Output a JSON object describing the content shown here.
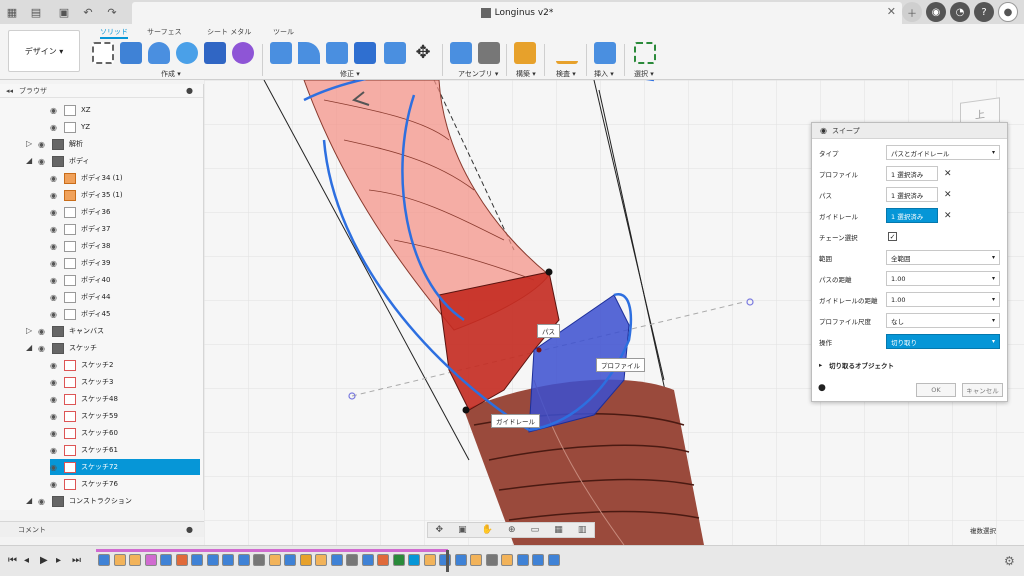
{
  "app": {
    "title": "Longinus v2*",
    "workspace_button": "デザイン ▾"
  },
  "ribbon": {
    "tabs": [
      "ソリッド",
      "サーフェス",
      "シート メタル",
      "ツール"
    ],
    "groups": [
      "作成 ▾",
      "修正 ▾",
      "アセンブリ ▾",
      "構築 ▾",
      "検査 ▾",
      "挿入 ▾",
      "選択 ▾"
    ]
  },
  "browser": {
    "title": "ブラウザ",
    "rows": [
      {
        "label": "XZ",
        "icon": "plane-icon"
      },
      {
        "label": "YZ",
        "icon": "plane-icon"
      },
      {
        "label": "解析",
        "icon": "folder-icon"
      },
      {
        "label": "ボディ",
        "icon": "folder-icon"
      },
      {
        "label": "ボディ34 (1)",
        "icon": "body-icon"
      },
      {
        "label": "ボディ35 (1)",
        "icon": "body-icon"
      },
      {
        "label": "ボディ36",
        "icon": "body-icon"
      },
      {
        "label": "ボディ37",
        "icon": "body-icon"
      },
      {
        "label": "ボディ38",
        "icon": "body-icon"
      },
      {
        "label": "ボディ39",
        "icon": "body-icon"
      },
      {
        "label": "ボディ40",
        "icon": "body-icon"
      },
      {
        "label": "ボディ44",
        "icon": "body-icon"
      },
      {
        "label": "ボディ45",
        "icon": "body-icon"
      },
      {
        "label": "キャンバス",
        "icon": "folder-icon"
      },
      {
        "label": "スケッチ",
        "icon": "folder-icon"
      },
      {
        "label": "スケッチ2",
        "icon": "sketch-icon"
      },
      {
        "label": "スケッチ3",
        "icon": "sketch-icon"
      },
      {
        "label": "スケッチ48",
        "icon": "sketch-icon"
      },
      {
        "label": "スケッチ59",
        "icon": "sketch-icon"
      },
      {
        "label": "スケッチ60",
        "icon": "sketch-icon"
      },
      {
        "label": "スケッチ61",
        "icon": "sketch-icon"
      },
      {
        "label": "スケッチ72",
        "icon": "sketch-icon"
      },
      {
        "label": "スケッチ76",
        "icon": "sketch-icon"
      },
      {
        "label": "コンストラクション",
        "icon": "folder-icon"
      }
    ],
    "comment_label": "コメント"
  },
  "viewport": {
    "labels": {
      "path": "パス",
      "profile": "プロファイル",
      "guide_rail": "ガイドレール"
    },
    "view_cube_face": "上",
    "status_right": "複数選択"
  },
  "sweep_dialog": {
    "title": "スイープ",
    "type_label": "タイプ",
    "type_value": "パスとガイドレール",
    "profile_label": "プロファイル",
    "profile_value": "1 選択済み",
    "path_label": "パス",
    "path_value": "1 選択済み",
    "guide_label": "ガイドレール",
    "guide_value": "1 選択済み",
    "chain_label": "チェーン選択",
    "extent_label": "範囲",
    "extent_value": "全範囲",
    "path_distance_label": "パスの距離",
    "path_distance_value": "1.00",
    "guide_distance_label": "ガイドレールの距離",
    "guide_distance_value": "1.00",
    "profile_scale_label": "プロファイル尺度",
    "profile_scale_value": "なし",
    "operation_label": "操作",
    "operation_value": "切り取り",
    "objects_label": "切り取るオブジェクト",
    "ok": "OK",
    "cancel": "キャンセル"
  },
  "colors": {
    "accent": "#0696d7",
    "body_pink": "#f4948a",
    "cut_red": "#c42a20",
    "profile_blue": "#3b4fd0",
    "body_brown": "#8a3a2e"
  }
}
